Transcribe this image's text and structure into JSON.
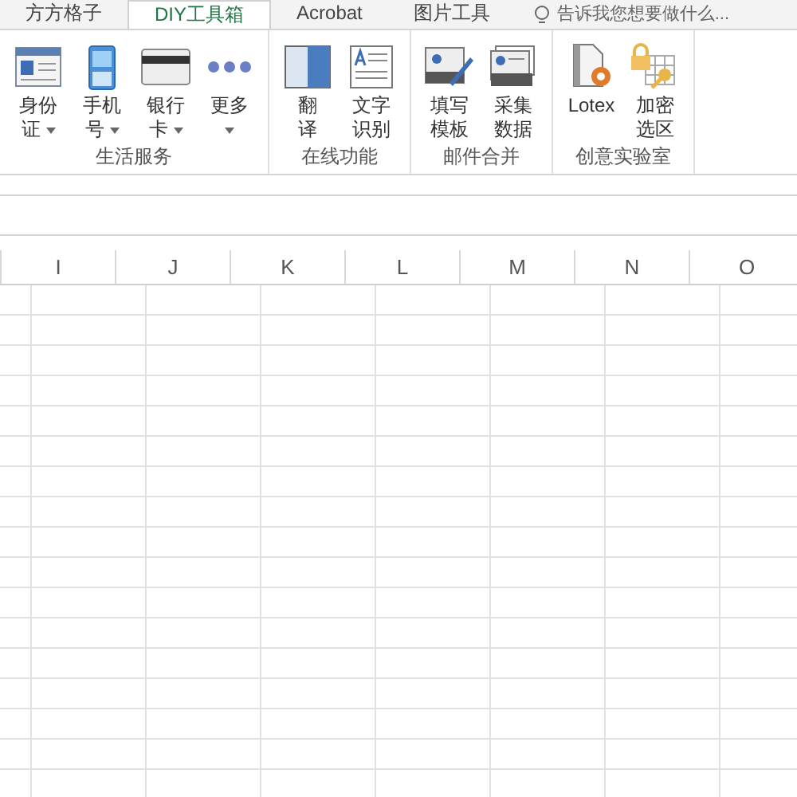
{
  "tabs": [
    {
      "label": "方方格子",
      "selected": false
    },
    {
      "label": "DIY工具箱",
      "selected": true
    },
    {
      "label": "Acrobat",
      "selected": false
    },
    {
      "label": "图片工具",
      "selected": false
    }
  ],
  "search": {
    "placeholder": "告诉我您想要做什么..."
  },
  "groups": [
    {
      "label": "生活服务",
      "buttons": [
        {
          "lines": [
            "身份",
            "证"
          ],
          "has_menu": true
        },
        {
          "lines": [
            "手机",
            "号"
          ],
          "has_menu": true
        },
        {
          "lines": [
            "银行",
            "卡"
          ],
          "has_menu": true
        },
        {
          "lines": [
            "更多"
          ],
          "has_menu": true
        }
      ]
    },
    {
      "label": "在线功能",
      "buttons": [
        {
          "lines": [
            "翻",
            "译"
          ],
          "has_menu": false
        },
        {
          "lines": [
            "文字",
            "识别"
          ],
          "has_menu": false
        }
      ]
    },
    {
      "label": "邮件合并",
      "buttons": [
        {
          "lines": [
            "填写",
            "模板"
          ],
          "has_menu": false
        },
        {
          "lines": [
            "采集",
            "数据"
          ],
          "has_menu": false
        }
      ]
    },
    {
      "label": "创意实验室",
      "buttons": [
        {
          "lines": [
            "Lotex"
          ],
          "has_menu": false
        },
        {
          "lines": [
            "加密",
            "选区"
          ],
          "has_menu": false
        }
      ]
    }
  ],
  "sheet": {
    "columns": [
      "I",
      "J",
      "K",
      "L",
      "M",
      "N",
      "O"
    ]
  }
}
